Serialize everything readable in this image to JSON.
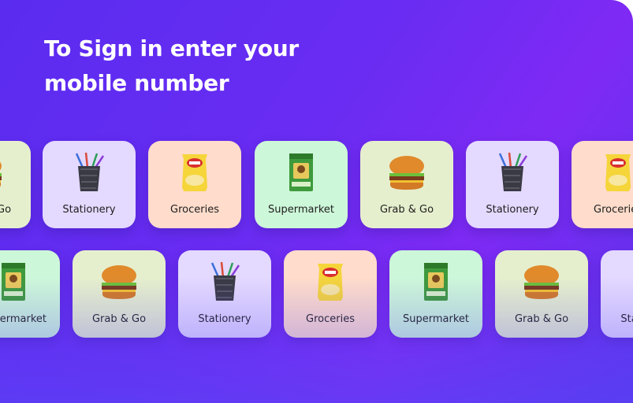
{
  "header": {
    "line1": "To Sign in enter your",
    "line2": "mobile number"
  },
  "row1": [
    {
      "label": "Grab & Go",
      "icon": "burger-icon",
      "bg": "#e6efcd"
    },
    {
      "label": "Stationery",
      "icon": "pencil-cup-icon",
      "bg": "#e4d9ff"
    },
    {
      "label": "Groceries",
      "icon": "chips-pack-icon",
      "bg": "#ffdccb"
    },
    {
      "label": "Supermarket",
      "icon": "grocery-pack-icon",
      "bg": "#cdf7d9"
    },
    {
      "label": "Grab & Go",
      "icon": "burger-icon",
      "bg": "#e6efcd"
    },
    {
      "label": "Stationery",
      "icon": "pencil-cup-icon",
      "bg": "#e4d9ff"
    },
    {
      "label": "Groceries",
      "icon": "chips-pack-icon",
      "bg": "#ffdccb"
    }
  ],
  "row2": [
    {
      "label": "Supermarket",
      "icon": "grocery-pack-icon",
      "bg": "#cdf7d9"
    },
    {
      "label": "Grab & Go",
      "icon": "burger-icon",
      "bg": "#e6efcd"
    },
    {
      "label": "Stationery",
      "icon": "pencil-cup-icon",
      "bg": "#e4d9ff"
    },
    {
      "label": "Groceries",
      "icon": "chips-pack-icon",
      "bg": "#ffdccb"
    },
    {
      "label": "Supermarket",
      "icon": "grocery-pack-icon",
      "bg": "#cdf7d9"
    },
    {
      "label": "Grab & Go",
      "icon": "burger-icon",
      "bg": "#e6efcd"
    },
    {
      "label": "Stationery",
      "icon": "pencil-cup-icon",
      "bg": "#e4d9ff"
    }
  ]
}
